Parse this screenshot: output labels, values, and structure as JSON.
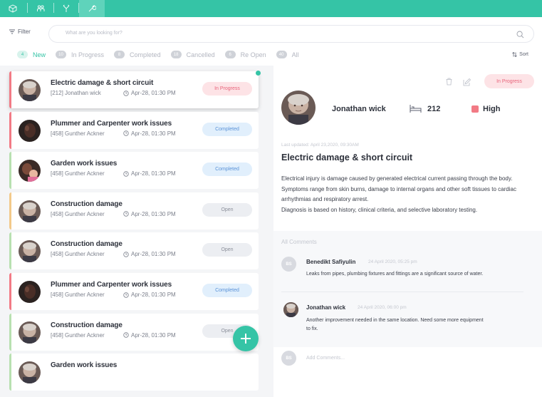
{
  "top_tabs": [
    {
      "icon": "cube-icon"
    },
    {
      "icon": "people-icon"
    },
    {
      "icon": "tools-icon"
    },
    {
      "icon": "tools-active-icon"
    }
  ],
  "search": {
    "filter_label": "Filter",
    "placeholder": "What are you looking for?"
  },
  "status_tabs": [
    {
      "count": "4",
      "label": "New",
      "active": true
    },
    {
      "count": "10",
      "label": "In Progress"
    },
    {
      "count": "8",
      "label": "Completed"
    },
    {
      "count": "18",
      "label": "Cancelled"
    },
    {
      "count": "6",
      "label": "Re Open"
    },
    {
      "count": "40",
      "label": "All"
    }
  ],
  "sort_label": "Sort",
  "tickets": [
    {
      "title": "Electric damage & short circuit",
      "sub": "[212] Jonathan wick",
      "time": "Apr-28, 01:30 PM",
      "status": "In Progress",
      "accent": "#f27a85"
    },
    {
      "title": "Plummer and Carpenter work issues",
      "sub": "[458] Gunther Ackner",
      "time": "Apr-28, 01:30 PM",
      "status": "Completed",
      "accent": "#f27a85"
    },
    {
      "title": "Garden work issues",
      "sub": "[458] Gunther Ackner",
      "time": "Apr-28, 01:30 PM",
      "status": "Completed",
      "accent": "#b8e0b0"
    },
    {
      "title": "Construction damage",
      "sub": "[458] Gunther Ackner",
      "time": "Apr-28, 01:30 PM",
      "status": "Open",
      "accent": "#f3c98a"
    },
    {
      "title": "Construction damage",
      "sub": "[458] Gunther Ackner",
      "time": "Apr-28, 01:30 PM",
      "status": "Open",
      "accent": "#b8e0b0"
    },
    {
      "title": "Plummer and Carpenter work issues",
      "sub": "[458] Gunther Ackner",
      "time": "Apr-28, 01:30 PM",
      "status": "Completed",
      "accent": "#f27a85"
    },
    {
      "title": "Construction damage",
      "sub": "[458] Gunther Ackner",
      "time": "Apr-28, 01:30 PM",
      "status": "Open",
      "accent": "#b8e0b0"
    },
    {
      "title": "Garden work issues",
      "sub": "",
      "time": "",
      "status": "",
      "accent": "#b8e0b0"
    }
  ],
  "detail": {
    "status": "In Progress",
    "name": "Jonathan wick",
    "room": "212",
    "priority": "High",
    "updated": "Last updated: April 23,2020, 09:30AM",
    "title": "Electric damage & short circuit",
    "description": "Electrical injury is damage caused by generated electrical current passing through the body. Symptoms range from skin burns, damage to internal organs and other soft tissues to cardiac arrhythmias and respiratory arrest.",
    "description2": "Diagnosis is based on history, clinical criteria, and selective laboratory testing."
  },
  "comments": {
    "title": "All Comments",
    "items": [
      {
        "initials": "BS",
        "name": "Benedikt Safiyulin",
        "date": "24 April 2020, 05:25 pm",
        "text": "Leaks from pipes, plumbing fixtures and fittings are a significant source of water."
      },
      {
        "initials": "",
        "name": "Jonathan wick",
        "date": "24 April 2020, 06:00 pm",
        "text": "Another improvement needed in the same location. Need some more equipment to fix."
      }
    ],
    "add_initials": "BS",
    "add_placeholder": "Add Comments..."
  },
  "colors": {
    "accent": "#35c4a6",
    "in_progress": "#e8637a",
    "completed": "#5b93d8",
    "priority_high": "#f27a85"
  }
}
